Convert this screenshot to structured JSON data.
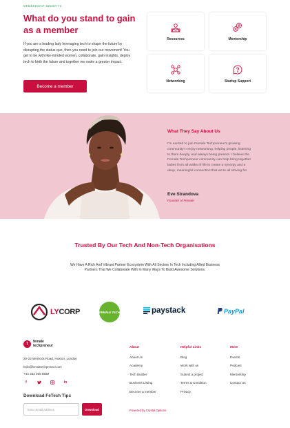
{
  "benefits": {
    "eyebrow": "MEMBERSHIP BENEFITS",
    "title": "What do you stand to gain as a member",
    "body": "If you are a leading lady leveraging tech to shape the future by disrupting the status quo, then you need to join our movement! You get to be  with like-minded women, collaborate, gain insights, deploy tech to birth the future and together we make a greater impact.",
    "cta": "Become a member",
    "cards": [
      {
        "label": "Resources",
        "icon": "resources-icon"
      },
      {
        "label": "Mentorship",
        "icon": "mentorship-icon"
      },
      {
        "label": "Networking",
        "icon": "networking-icon"
      },
      {
        "label": "Startup Support",
        "icon": "startup-support-icon"
      }
    ]
  },
  "testimonial": {
    "heading": "What They Say About Us",
    "quote": "I'm excited to join Female Techpreneur's growing community! I enjoy networking, helping people, listening to them deeply, and always being present. I believe the Female Techpreneur community can help bring together ladies from all walks of life to create a synergy and a deep, meaningful connection that we're all striving for.",
    "name": "Eve  Strandova",
    "role": "Founder of Female"
  },
  "trusted": {
    "title": "Trusted By Our Tech And Non-Tech Organisations",
    "body": "We Have A Rich And Vibrant Partner Ecosystem With All Sectors In Tech Including Allied Business Partners That We Collaborate With In Many Ways To Build Awesome Solutions.",
    "logos": {
      "lycorp_a": "LY",
      "lycorp_b": "CORP",
      "green": "FEMALE TECH",
      "paystack": "paystack",
      "paypal_a": "Pay",
      "paypal_b": "Pal"
    }
  },
  "footer": {
    "logo_line1": "female",
    "logo_line2": "techpreneur",
    "address": "20-22 Wenlock Road, Hoxton, London",
    "email": "hello@femaletechpreneur.com",
    "phone": "+44 333 305 5939",
    "tips_heading": "Download FeTech Tips",
    "email_placeholder": "Enter Email Address",
    "download_label": "Download",
    "about": {
      "heading": "About",
      "items": [
        "About Us",
        "Academy",
        "Tech Builder",
        "Business Listing",
        "Become a member"
      ]
    },
    "help": {
      "heading": "Helpful Links",
      "items": [
        "Blog",
        "Work with us",
        "Submit a project",
        "Terms & Condition",
        "Privacy"
      ]
    },
    "more": {
      "heading": "More",
      "items": [
        "Events",
        "Podcast",
        "Mentorship",
        "Contact Us"
      ]
    },
    "powered": "Powered by Crystal Options"
  },
  "colors": {
    "brand": "#c8103f",
    "pink_bg": "#f1c8d2",
    "eyebrow": "#59b77a"
  }
}
